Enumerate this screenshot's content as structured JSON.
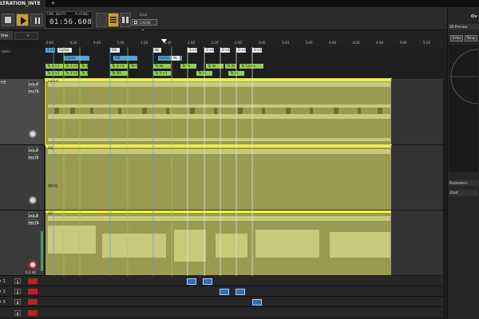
{
  "window": {
    "title": "LTRATION_INTE",
    "new_tab": "+",
    "right_tab": "Ov"
  },
  "transport": {
    "time_label": "TIME",
    "beats_label": "BEATS",
    "status": "PLAYING",
    "time": "01:56.608",
    "element_label": "Elast",
    "element_value": "CACHE"
  },
  "tabs": {
    "active": "line",
    "add": "+"
  },
  "ruler": {
    "ticks": [
      "0:00",
      "0:20",
      "0:40",
      "1:00",
      "1:20",
      "1:40",
      "2:00",
      "2:20",
      "2:40",
      "3:00",
      "3:20",
      "3:40",
      "4:00",
      "4:20",
      "4:40",
      "5:00",
      "5:20"
    ]
  },
  "markers_label": "racks",
  "markers": {
    "row1": [
      "1 +40 4/4",
      "Cache",
      "SIS",
      "Vo",
      "1->2",
      "1->3",
      "2->1",
      "2->3",
      "3->1"
    ],
    "row2": [
      "Cache",
      "SIS",
      "Cache",
      "Vo"
    ],
    "row3": [
      "To 3->1",
      "To 3->2",
      "To 3->2",
      "To 3->3",
      "To CAC",
      "To Vo",
      "To Vo",
      "To Vo",
      "To Vo",
      "To Cache",
      "To Cache",
      "To Vo"
    ],
    "row4": [
      "To 3->2",
      "To 3->2",
      "To 3->3",
      "To SIS",
      "To 3->1",
      "To Vo",
      "To Vo"
    ]
  },
  "tracks": [
    {
      "name": "HE",
      "solo": "SOLO",
      "mute": "MUTE",
      "clip": "CACHE",
      "active": true
    },
    {
      "name": "",
      "solo": "SOLO",
      "mute": "MUTE",
      "clip": "SIS",
      "active": false
    },
    {
      "name": "",
      "solo": "SOLO",
      "mute": "MUTE",
      "clip": "VO",
      "active": false,
      "level": "0.0 dB"
    }
  ],
  "subtracks": [
    {
      "name": "r 1",
      "num": "1"
    },
    {
      "name": "r 2",
      "num": "2"
    },
    {
      "name": "r 3",
      "num": "3"
    },
    {
      "name": "",
      "num": "4"
    }
  ],
  "right_panel": {
    "preview_header": "3D Preview",
    "ortho": "Ortho",
    "persp": "Persp",
    "params_header": "Parameters",
    "params_item": "Elast"
  },
  "colors": {
    "accent": "#f0f04a",
    "clip": "#9a9a52",
    "marker_blue": "#4fa3e0",
    "marker_green": "#8fd24a"
  }
}
